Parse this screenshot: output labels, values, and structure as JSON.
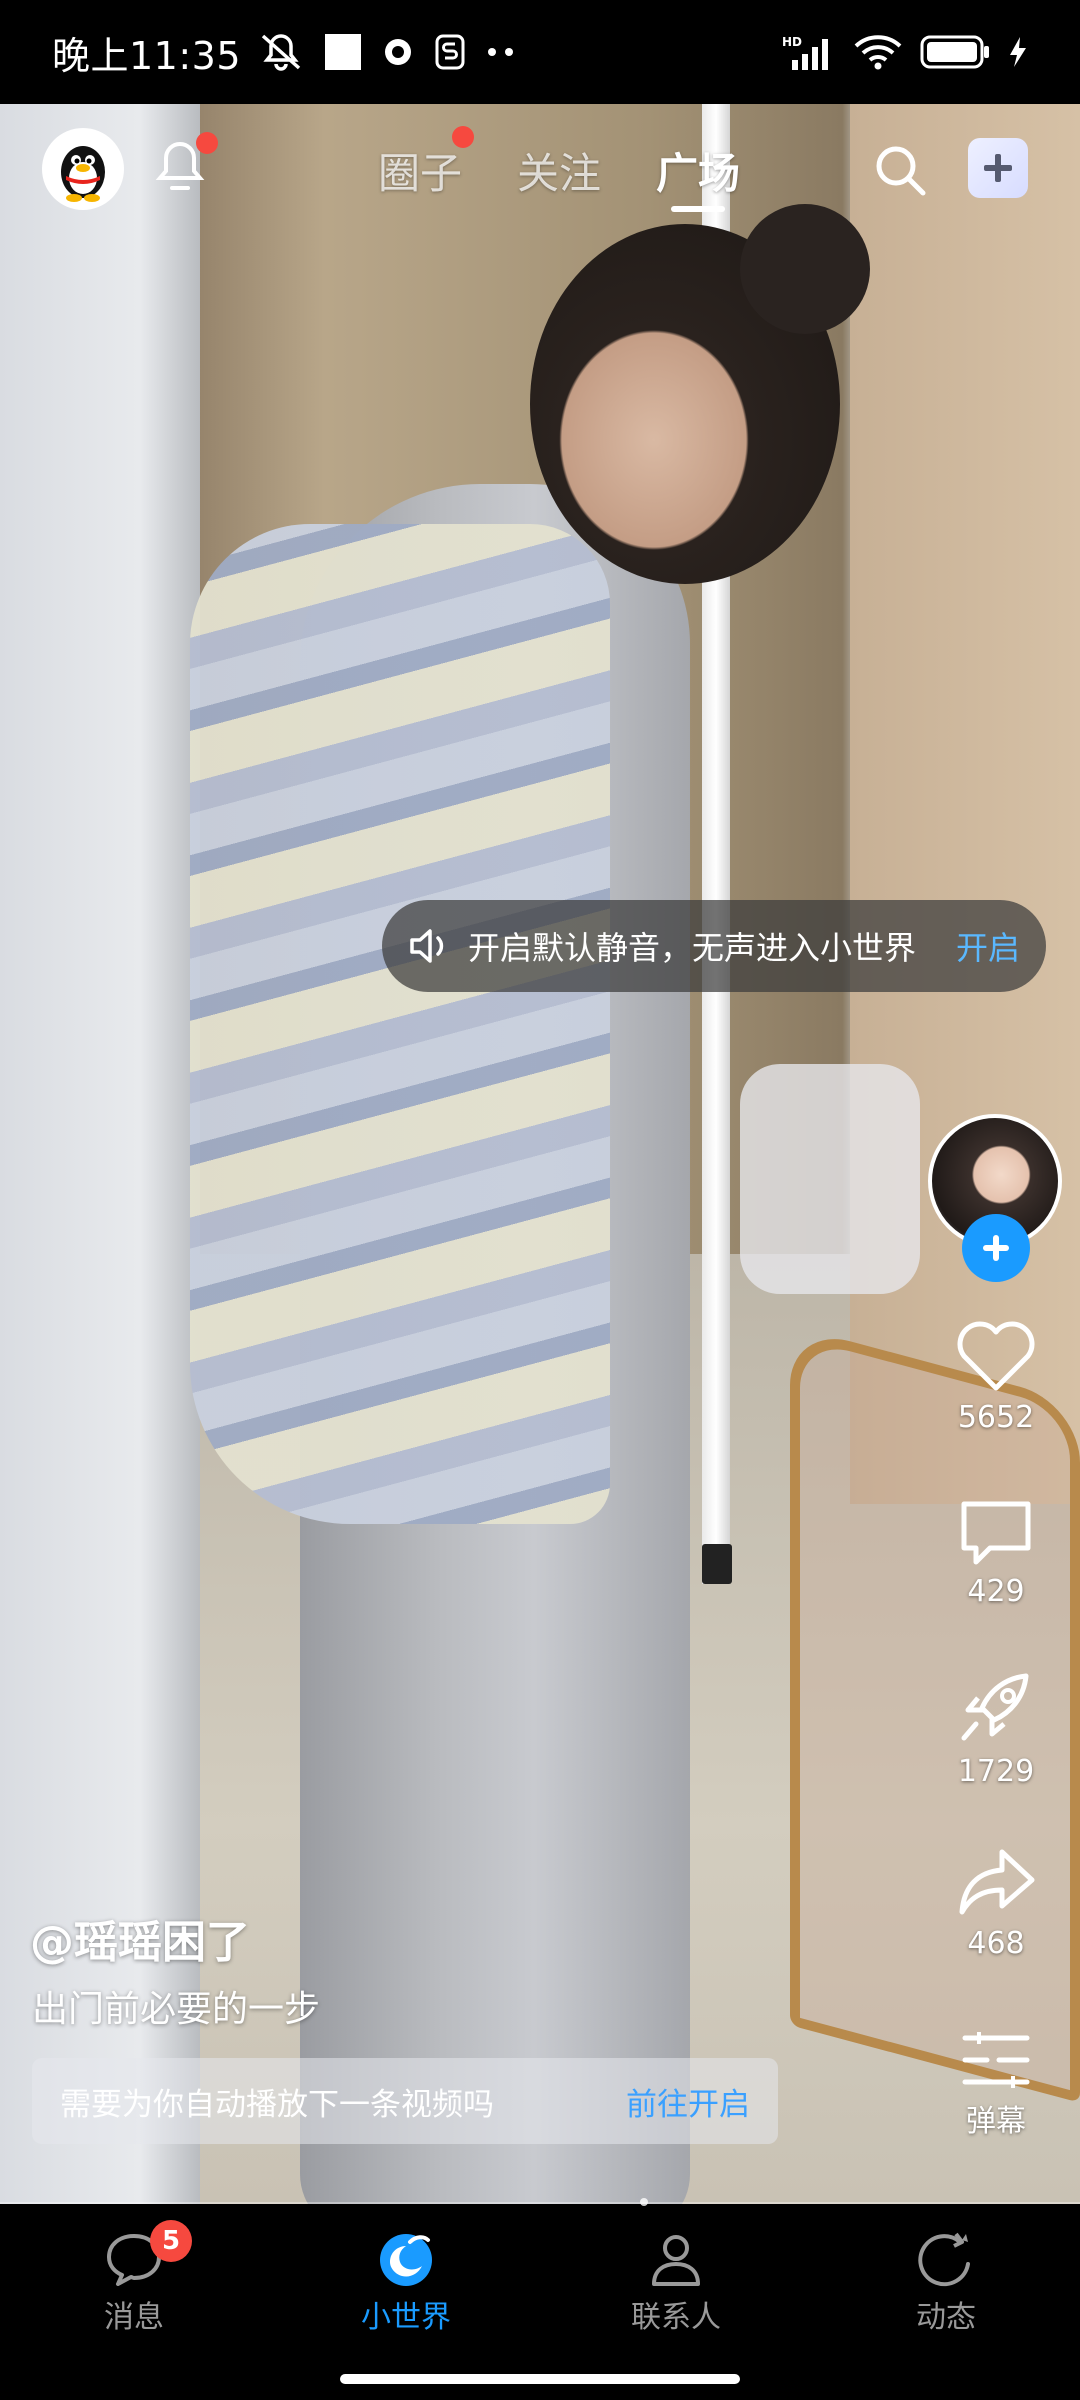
{
  "status_bar": {
    "time": "晚上11:35",
    "left_icons": [
      "muted-bell-icon",
      "square-icon",
      "record-icon",
      "s-app-icon",
      "more-dots-icon"
    ],
    "right_icons": [
      "hd-signal-icon",
      "wifi-icon",
      "battery-icon",
      "charging-icon"
    ]
  },
  "top_nav": {
    "tabs": [
      {
        "label": "圈子",
        "has_dot": true
      },
      {
        "label": "关注",
        "has_dot": false
      },
      {
        "label": "广场",
        "active": true
      }
    ],
    "bell_has_dot": true
  },
  "mute_toast": {
    "text": "开启默认静音，无声进入小世界",
    "action": "开启"
  },
  "actions": {
    "like_count": "5652",
    "comment_count": "429",
    "boost_count": "1729",
    "share_count": "468",
    "danmaku_label": "弹幕"
  },
  "post": {
    "author": "@瑶瑶困了",
    "caption": "出门前必要的一步"
  },
  "autoplay_prompt": {
    "text": "需要为你自动播放下一条视频吗",
    "action": "前往开启"
  },
  "bottom_nav": {
    "tabs": [
      {
        "label": "消息",
        "badge": "5"
      },
      {
        "label": "小世界",
        "active": true
      },
      {
        "label": "联系人"
      },
      {
        "label": "动态"
      }
    ]
  },
  "colors": {
    "accent": "#1a9bff",
    "badge_red": "#f6493f",
    "link_blue": "#5ab8ff"
  }
}
